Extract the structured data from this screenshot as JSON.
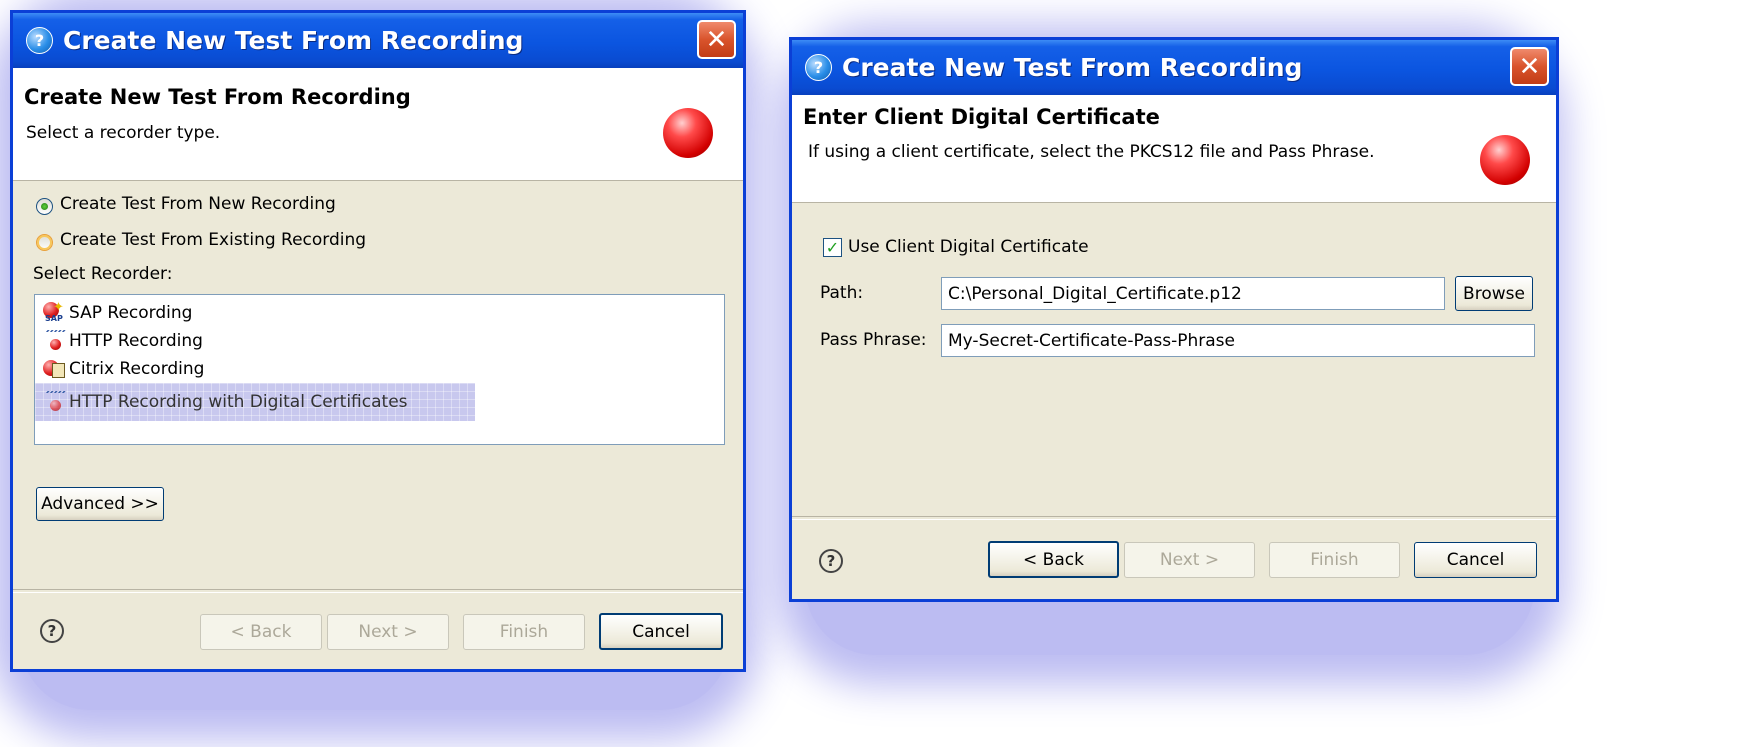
{
  "dialog_left": {
    "window_title": "Create New Test From Recording",
    "header_title": "Create New Test From Recording",
    "header_subtitle": "Select a recorder type.",
    "radio_new": "Create Test From New Recording",
    "radio_existing": "Create Test From Existing Recording",
    "select_recorder_label": "Select Recorder:",
    "recorders": [
      {
        "label": "SAP Recording",
        "icon": "sap-recording-icon"
      },
      {
        "label": "HTTP Recording",
        "icon": "http-recording-icon"
      },
      {
        "label": "Citrix Recording",
        "icon": "citrix-recording-icon"
      },
      {
        "label": "HTTP Recording with Digital Certificates",
        "icon": "http-certificate-recording-icon"
      }
    ],
    "selected_recorder": "HTTP Recording with Digital Certificates",
    "advanced_button": "Advanced >>",
    "back_button": "< Back",
    "next_button": "Next >",
    "finish_button": "Finish",
    "cancel_button": "Cancel",
    "help_icon": "?"
  },
  "dialog_right": {
    "window_title": "Create New Test From Recording",
    "header_title": "Enter Client Digital Certificate",
    "header_subtitle": "If using a client certificate, select the PKCS12 file and Pass Phrase.",
    "checkbox_label": "Use Client Digital Certificate",
    "path_label": "Path:",
    "path_value": "C:\\Personal_Digital_Certificate.p12",
    "browse_button": "Browse",
    "passphrase_label": "Pass Phrase:",
    "passphrase_value": "My-Secret-Certificate-Pass-Phrase",
    "back_button": "< Back",
    "next_button": "Next >",
    "finish_button": "Finish",
    "cancel_button": "Cancel",
    "help_icon": "?"
  },
  "colors": {
    "titlebar": "#0b55e0",
    "dialog_body": "#ece9d8",
    "selection": "#c8c8ee",
    "glow": "#bcbcf2"
  }
}
